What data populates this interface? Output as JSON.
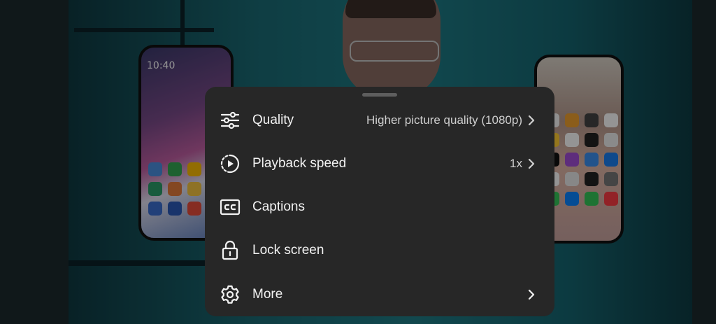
{
  "background": {
    "phone_left_clock": "10:40"
  },
  "menu": {
    "items": [
      {
        "label": "Quality",
        "value": "Higher picture quality (1080p)",
        "icon": "quality-sliders-icon",
        "has_chevron": true
      },
      {
        "label": "Playback speed",
        "value": "1x",
        "icon": "playback-speed-icon",
        "has_chevron": true
      },
      {
        "label": "Captions",
        "value": "",
        "icon": "captions-icon",
        "has_chevron": false
      },
      {
        "label": "Lock screen",
        "value": "",
        "icon": "lock-icon",
        "has_chevron": false
      },
      {
        "label": "More",
        "value": "",
        "icon": "gear-icon",
        "has_chevron": true
      }
    ]
  },
  "colors": {
    "sheet_bg": "#272727",
    "text_primary": "#f2f2f2",
    "text_secondary": "#cfcfcf"
  }
}
